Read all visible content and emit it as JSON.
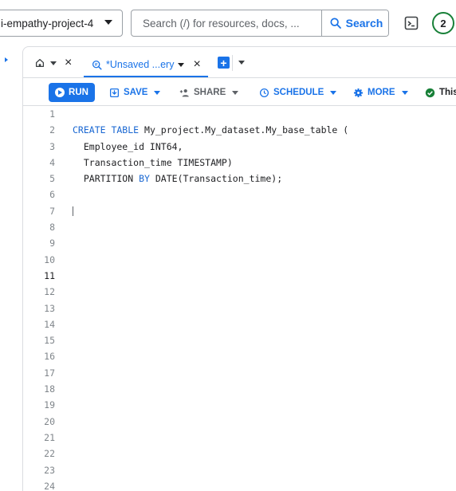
{
  "topbar": {
    "project_name": "i-empathy-project-4",
    "search_placeholder": "Search (/) for resources, docs, ...",
    "search_button": "Search",
    "notification_count": "2"
  },
  "tabs": {
    "query_tab_label": "*Unsaved ...ery",
    "close_symbol": "×"
  },
  "toolbar": {
    "run_label": "RUN",
    "save_label": "SAVE",
    "share_label": "SHARE",
    "schedule_label": "SCHEDULE",
    "more_label": "MORE",
    "status_label": "This"
  },
  "editor": {
    "line_numbers": [
      "1",
      "2",
      "3",
      "4",
      "5",
      "6",
      "7",
      "8",
      "9",
      "10",
      "11",
      "12",
      "13",
      "14",
      "15",
      "16",
      "17",
      "18",
      "19",
      "20",
      "21",
      "22",
      "23",
      "24"
    ],
    "active_line": "11",
    "line2_kw": "CREATE TABLE",
    "line2_rest": " My_project.My_dataset.My_base_table (",
    "line3": "  Employee_id INT64,",
    "line4": "  Transaction_time TIMESTAMP)",
    "line5_a": "  PARTITION ",
    "line5_kw": "BY",
    "line5_b": " DATE(Transaction_time);"
  },
  "colors": {
    "accent": "#1a73e8",
    "keyword": "#1967d2",
    "success": "#188038"
  }
}
